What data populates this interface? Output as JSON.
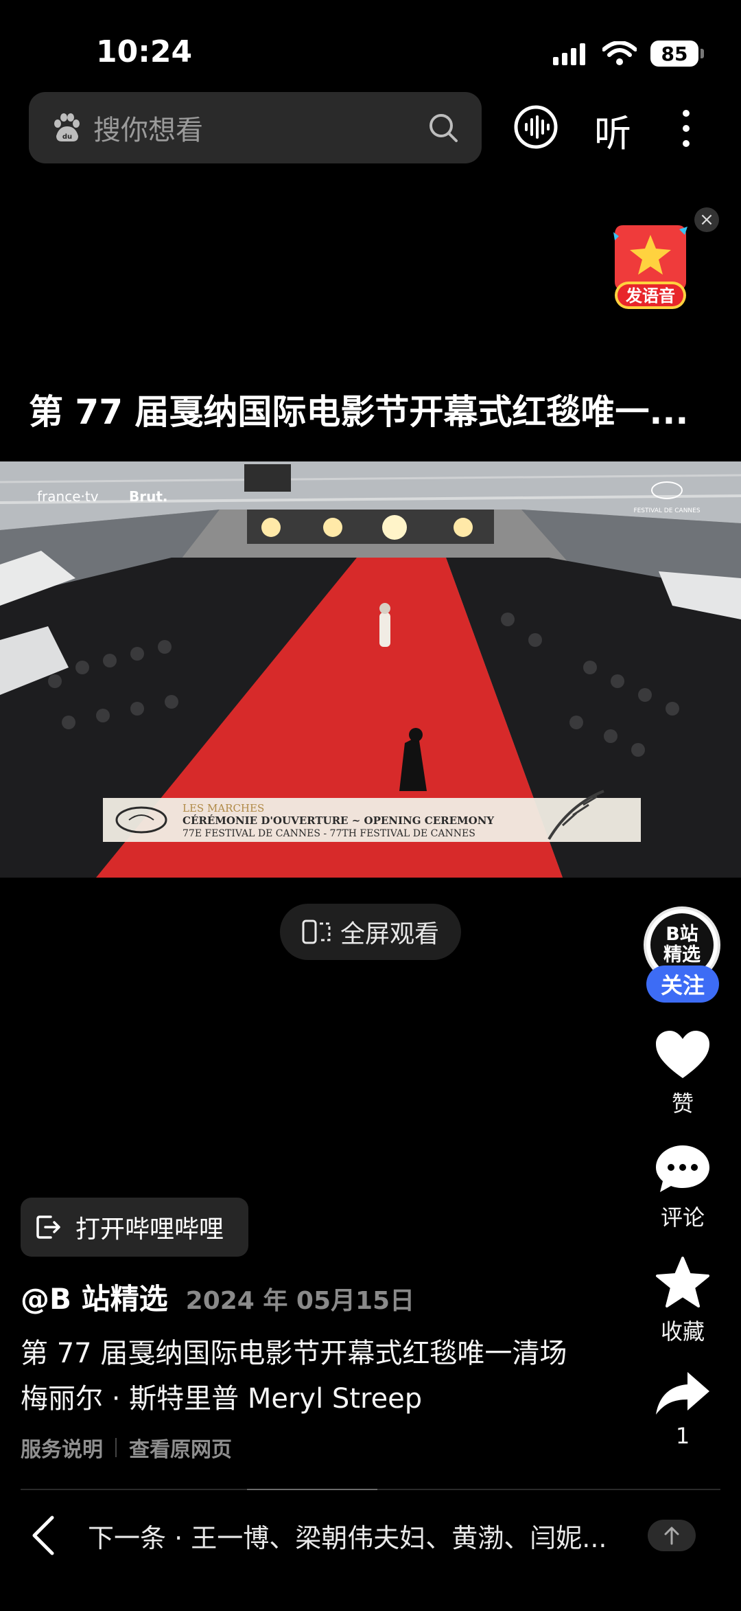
{
  "status_bar": {
    "time": "10:24",
    "battery": "85"
  },
  "header": {
    "search_placeholder": "搜你想看",
    "listen_label": "听"
  },
  "promo": {
    "badge_text": "发语音"
  },
  "video": {
    "title": "第 77 届戛纳国际电影节开幕式红毯唯一...",
    "overlay": {
      "brand_left": "france·tv",
      "brand_right": "Brut.",
      "festival_logo_text": "FESTIVAL DE CANNES",
      "lower_third_line1": "LES MARCHES",
      "lower_third_line2": "CÉRÉMONIE D'OUVERTURE ~ OPENING CEREMONY",
      "lower_third_line3": "77E FESTIVAL DE CANNES - 77TH FESTIVAL DE CANNES"
    },
    "fullscreen_label": "全屏观看"
  },
  "rail": {
    "avatar_text_line1": "B站",
    "avatar_text_line2": "精选",
    "follow_label": "关注",
    "like_label": "赞",
    "comment_label": "评论",
    "collect_label": "收藏",
    "share_count": "1"
  },
  "post": {
    "open_app_label": "打开哔哩哔哩",
    "author": "@B 站精选",
    "date": "2024 年 05月15日",
    "description_line1": "第 77 届戛纳国际电影节开幕式红毯唯一清场",
    "description_line2": "梅丽尔 · 斯特里普 Meryl Streep",
    "link_service": "服务说明",
    "link_original": "查看原网页"
  },
  "next": {
    "text": "下一条 · 王一博、梁朝伟夫妇、黄渤、闫妮..."
  },
  "colors": {
    "follow_blue": "#3d6cf5",
    "carpet_red": "#d72a2a",
    "badge_red": "#ef3b3b"
  }
}
